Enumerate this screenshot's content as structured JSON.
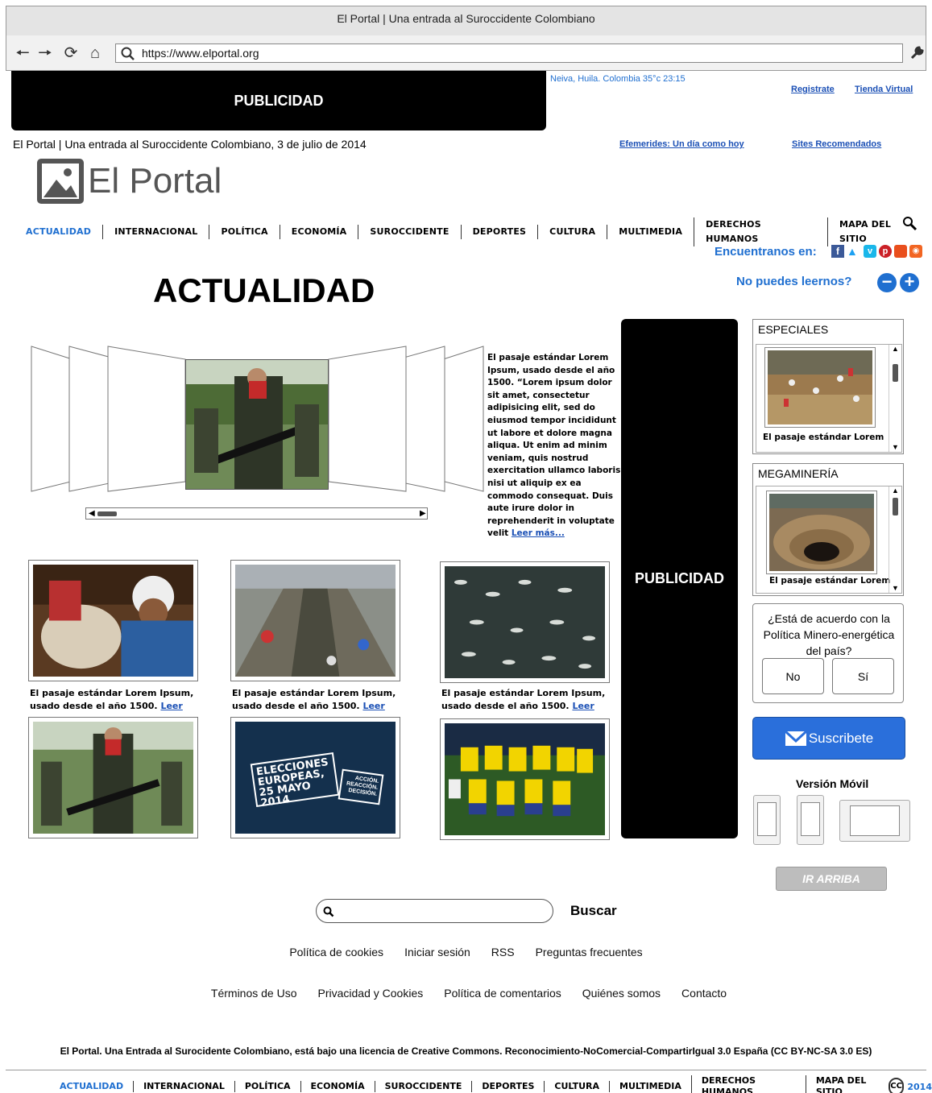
{
  "browser": {
    "title": "El Portal | Una entrada al Suroccidente Colombiano",
    "url": "https://www.elportal.org"
  },
  "top": {
    "ad_label": "PUBLICIDAD",
    "weather": "Neiva, Huila. Colombia  35°c   23:15",
    "register": "Registrate",
    "store": "Tienda Virtual",
    "tagline": "El Portal | Una entrada al Suroccidente Colombiano, 3 de julio de 2014",
    "efemerides": "Efemerides: Un día como hoy",
    "sites": "Sites Recomendados",
    "logo_text": "El Portal"
  },
  "nav": [
    "ACTUALIDAD",
    "INTERNACIONAL",
    "POLÍTICA",
    "ECONOMÍA",
    "SUROCCIDENTE",
    "DEPORTES",
    "CULTURA",
    "MULTIMEDIA",
    "DERECHOS HUMANOS",
    "MAPA DEL SITIO"
  ],
  "social": {
    "label": "Encuentranos en:"
  },
  "readability": {
    "label": "No puedes leernos?"
  },
  "section_title": "ACTUALIDAD",
  "featured": {
    "text": "El pasaje estándar Lorem Ipsum, usado desde el año 1500.  “Lorem ipsum dolor sit amet, consectetur adipisicing elit, sed do eiusmod tempor incididunt ut labore et dolore magna aliqua. Ut enim ad minim veniam, quis nostrud exercitation ullamco laboris nisi ut aliquip ex ea commodo consequat. Duis aute irure dolor in reprehenderit in voluptate velit",
    "more": "Leer más..."
  },
  "side_ad": "PUBLICIDAD",
  "articles": {
    "caption": "El pasaje estándar Lorem Ipsum, usado desde el año 1500.",
    "read": "Leer",
    "election_poster": [
      "ELECCIONES",
      "EUROPEAS,",
      "25 MAYO 2014",
      "ACCIÓN.",
      "REACCIÓN.",
      "DECISIÓN."
    ]
  },
  "sidebar": {
    "especiales_title": "ESPECIALES",
    "especiales_caption": "El pasaje estándar Lorem",
    "megamineria_title": "MEGAMINERÍA",
    "megamineria_caption": "El pasaje estándar Lorem",
    "poll_question": "¿Está de acuerdo con la Política Minero-energética del país?",
    "poll_no": "No",
    "poll_yes": "Sí",
    "subscribe": "Suscribete",
    "mobile_title": "Versión Móvil",
    "up_button": "IR ARRIBA"
  },
  "search": {
    "button": "Buscar",
    "placeholder": ""
  },
  "footer": {
    "row1": [
      "Política de cookies",
      "Iniciar sesión",
      "RSS",
      "Preguntas frecuentes"
    ],
    "row2": [
      "Términos de Uso",
      "Privacidad y Cookies",
      "Política de comentarios",
      "Quiénes somos",
      "Contacto"
    ],
    "license": "El Portal. Una Entrada al Surocidente Colombiano, está bajo una licencia de Creative Commons. Reconocimiento-NoComercial-CompartirIgual 3.0 España (CC BY-NC-SA 3.0 ES)",
    "cc": "CC",
    "year": "2014"
  },
  "colors": {
    "accent": "#1f6fd0",
    "subscribe": "#2a6fdb"
  }
}
